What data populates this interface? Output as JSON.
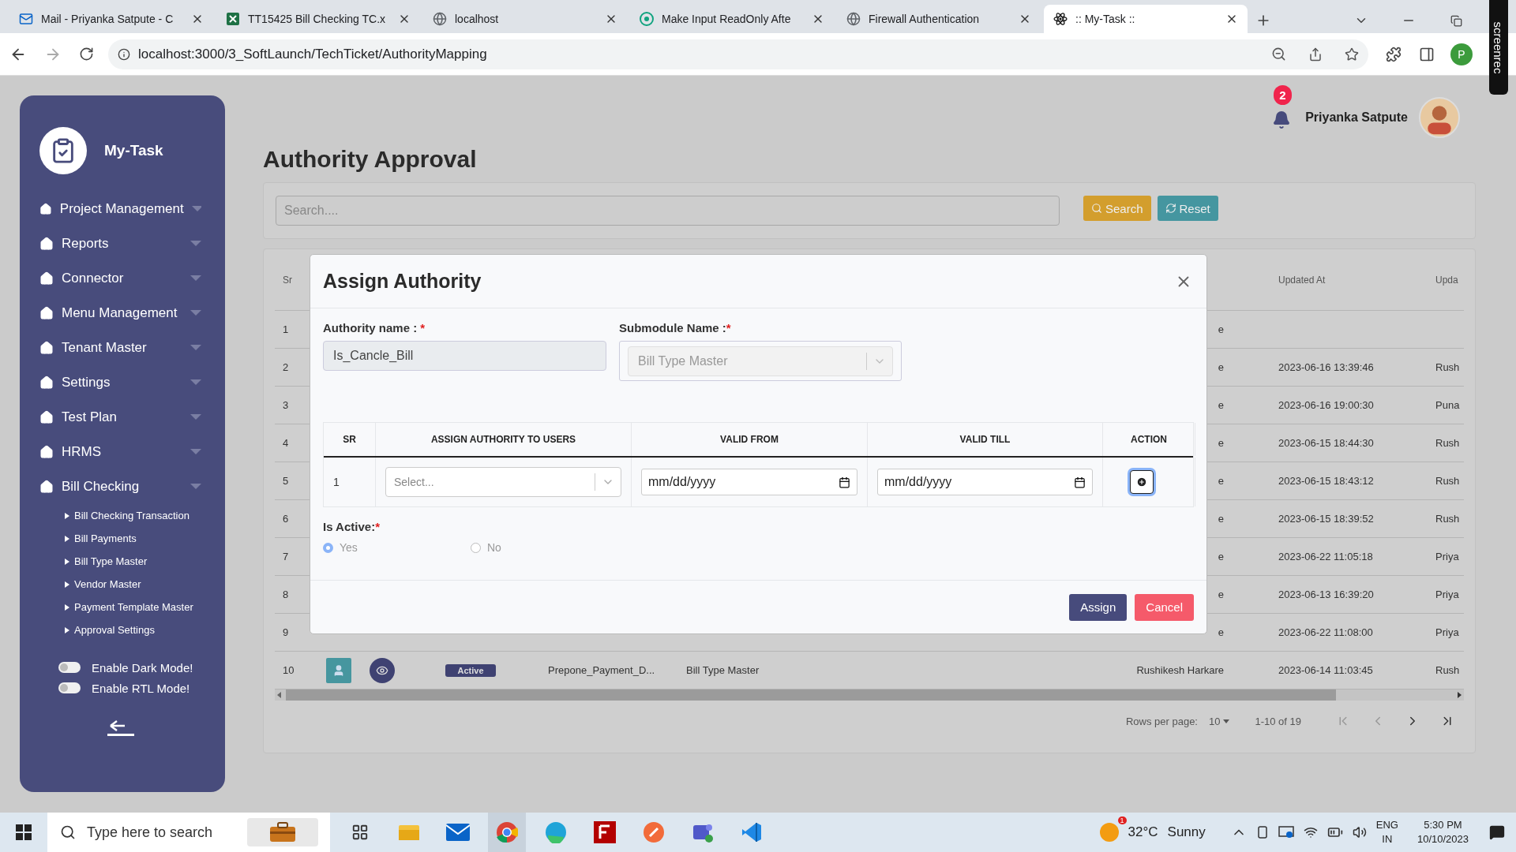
{
  "browser": {
    "tabs": [
      {
        "title": "Mail - Priyanka Satpute - C",
        "kind": "mail",
        "selected": false
      },
      {
        "title": "TT15425 Bill Checking TC.x",
        "kind": "sheet",
        "selected": false
      },
      {
        "title": "localhost",
        "kind": "globe",
        "selected": false
      },
      {
        "title": "Make Input ReadOnly Afte",
        "kind": "chat",
        "selected": false
      },
      {
        "title": "Firewall Authentication",
        "kind": "globe",
        "selected": false
      },
      {
        "title": ":: My-Task ::",
        "kind": "react",
        "selected": true
      }
    ],
    "address": "localhost:3000/3_SoftLaunch/TechTicket/AuthorityMapping",
    "profile": "P"
  },
  "recorder_tab": "screenrec",
  "sidebar": {
    "brand": "My-Task",
    "items": [
      {
        "label": "Project Management"
      },
      {
        "label": "Reports"
      },
      {
        "label": "Connector"
      },
      {
        "label": "Menu Management"
      },
      {
        "label": "Tenant Master"
      },
      {
        "label": "Settings"
      },
      {
        "label": "Test Plan"
      },
      {
        "label": "HRMS"
      },
      {
        "label": "Bill Checking",
        "children": [
          {
            "label": "Bill Checking Transaction"
          },
          {
            "label": "Bill Payments"
          },
          {
            "label": "Bill Type Master"
          },
          {
            "label": "Vendor Master"
          },
          {
            "label": "Payment Template Master"
          },
          {
            "label": "Approval Settings"
          }
        ]
      }
    ],
    "toggles": [
      {
        "label": "Enable Dark Mode!",
        "on": false
      },
      {
        "label": "Enable RTL Mode!",
        "on": false
      }
    ]
  },
  "header": {
    "notification_count": "2",
    "user_name": "Priyanka Satpute"
  },
  "page": {
    "title": "Authority Approval",
    "search": {
      "placeholder": "Search....",
      "buttons": [
        {
          "label": "Search",
          "kind": "search"
        },
        {
          "label": "Reset",
          "kind": "reset"
        }
      ]
    }
  },
  "table": {
    "header": {
      "sr": "Sr",
      "updated_at": "Updated At",
      "column_9": "Upda"
    },
    "rows": [
      {
        "sr": "1",
        "column_7": "e"
      },
      {
        "sr": "2",
        "column_7": "e",
        "updated_at": "2023-06-16 13:39:46",
        "column_9": "Rush"
      },
      {
        "sr": "3",
        "column_7": "e",
        "updated_at": "2023-06-16 19:00:30",
        "column_9": "Puna"
      },
      {
        "sr": "4",
        "column_7": "e",
        "updated_at": "2023-06-15 18:44:30",
        "column_9": "Rush"
      },
      {
        "sr": "5",
        "column_7": "e",
        "updated_at": "2023-06-15 18:43:12",
        "column_9": "Rush"
      },
      {
        "sr": "6",
        "column_7": "e",
        "updated_at": "2023-06-15 18:39:52",
        "column_9": "Rush"
      },
      {
        "sr": "7",
        "column_7": "e",
        "updated_at": "2023-06-22 11:05:18",
        "column_9": "Priya"
      },
      {
        "sr": "8",
        "column_7": "e",
        "updated_at": "2023-06-13 16:39:20",
        "column_9": "Priya"
      },
      {
        "sr": "9",
        "column_7": "e",
        "updated_at": "2023-06-22 11:08:00",
        "column_9": "Priya"
      },
      {
        "sr": "10",
        "status": "Active",
        "column_5": "Prepone_Payment_D...",
        "column_6": "Bill Type Master",
        "column_7": "Rushikesh Harkare",
        "updated_at": "2023-06-14 11:03:45",
        "column_9": "Rush"
      }
    ],
    "pagination": {
      "rows_per_page_label": "Rows per page:",
      "rows_per_page": "10",
      "range": "1-10 of 19"
    }
  },
  "modal": {
    "title": "Assign Authority",
    "fields": [
      {
        "label": "Authority name : ",
        "required_mark": "*",
        "value": "Is_Cancle_Bill",
        "kind": "input"
      },
      {
        "label": "Submodule Name :",
        "required_mark": "*",
        "value": "Bill Type Master",
        "kind": "select"
      }
    ],
    "grid": {
      "columns": [
        "SR",
        "ASSIGN AUTHORITY TO USERS",
        "VALID FROM",
        "VALID TILL",
        "ACTION"
      ],
      "rows": [
        {
          "sr": "1",
          "user_placeholder": "Select...",
          "valid_from": "mm/dd/yyyy",
          "valid_till": "mm/dd/yyyy"
        }
      ]
    },
    "is_active": {
      "label": "Is Active:",
      "required_mark": "*",
      "options": [
        {
          "label": "Yes",
          "selected": true
        },
        {
          "label": "No",
          "selected": false
        }
      ]
    },
    "buttons": [
      {
        "label": "Assign",
        "kind": "primary"
      },
      {
        "label": "Cancel",
        "kind": "danger"
      }
    ]
  },
  "taskbar": {
    "search_placeholder": "Type here to search",
    "weather": {
      "alert": "1",
      "temperature": "32°C",
      "condition": "Sunny"
    },
    "language": "ENG",
    "region": "IN",
    "time": "5:30 PM",
    "date": "10/10/2023"
  }
}
